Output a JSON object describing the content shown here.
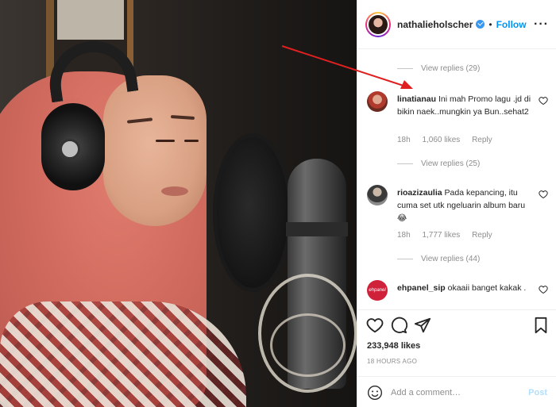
{
  "post": {
    "username": "nathalieholscher",
    "follow_label": "Follow",
    "dot": "•",
    "more": "···"
  },
  "comments": [
    {
      "type": "replies",
      "label": "View replies (29)"
    },
    {
      "type": "comment",
      "user": "linatianau",
      "text": "Ini mah Promo lagu .jd di bikin naek..mungkin ya Bun..sehat2",
      "time": "18h",
      "likes": "1,060 likes",
      "reply": "Reply"
    },
    {
      "type": "replies",
      "label": "View replies (25)"
    },
    {
      "type": "comment",
      "user": "rioazizaulia",
      "text": "Pada kepancing, itu cuma set utk ngeluarin album baru😂",
      "time": "18h",
      "likes": "1,777 likes",
      "reply": "Reply"
    },
    {
      "type": "replies",
      "label": "View replies (44)"
    },
    {
      "type": "comment",
      "user": "ehpanel_sip",
      "avatar_text": "ehpanel",
      "text": "okaaii banget kakak .",
      "time": "",
      "likes": "",
      "reply": ""
    }
  ],
  "actions": {
    "likes": "233,948 likes",
    "time": "18 HOURS AGO"
  },
  "add_comment": {
    "placeholder": "Add a comment…",
    "post_label": "Post"
  },
  "colors": {
    "accent": "#0095f6",
    "verified": "#3897f0",
    "annotation_arrow": "#e02020"
  }
}
